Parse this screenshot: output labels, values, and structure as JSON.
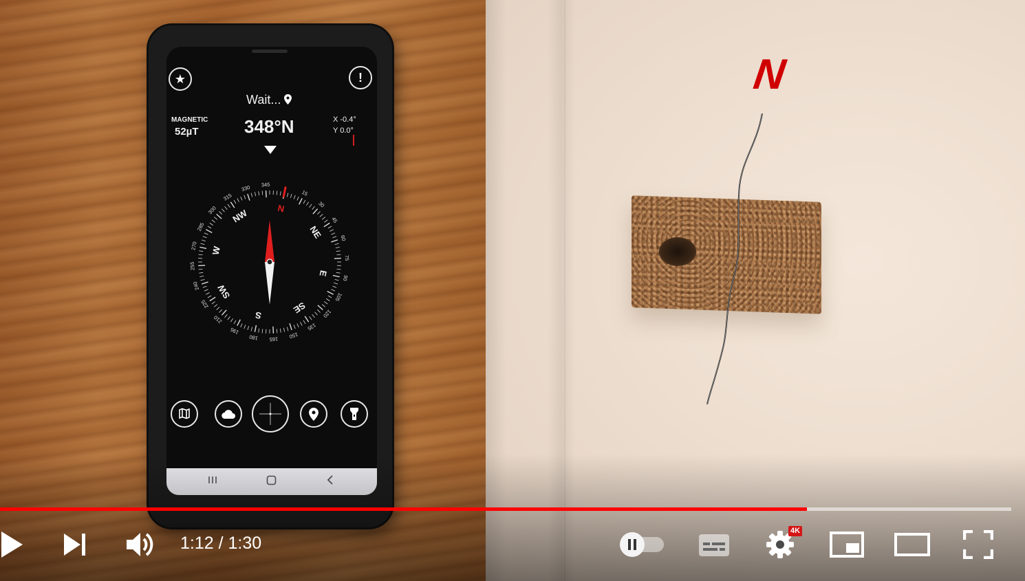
{
  "video": {
    "overlay_letter": "N",
    "phone_app": {
      "location_text": "Wait...",
      "magnetic_label": "MAGNETIC",
      "magnetic_value": "52µT",
      "heading": "348°N",
      "tilt_x": "X -0.4°",
      "tilt_y": "Y 0.0°",
      "info_symbol": "!",
      "favorite_symbol": "★",
      "dial": {
        "cardinals": [
          "N",
          "NE",
          "E",
          "SE",
          "S",
          "SW",
          "W",
          "NW"
        ],
        "degree_labels": [
          "345",
          "15",
          "30",
          "45",
          "60",
          "75",
          "90",
          "105",
          "120",
          "135",
          "150",
          "165",
          "180",
          "195",
          "210",
          "225",
          "240",
          "255",
          "270",
          "285",
          "300",
          "315",
          "330"
        ]
      },
      "toolbar_icons": [
        "map-icon",
        "cloud-icon",
        "crosshair-icon",
        "location-pin-icon",
        "flashlight-icon"
      ]
    }
  },
  "player": {
    "current_time": "1:12",
    "duration": "1:30",
    "time_text": "1:12 / 1:30",
    "progress_fraction": 0.798,
    "quality_badge": "4K",
    "accent_color": "#ff0000",
    "controls": [
      "play-icon",
      "next-icon",
      "volume-icon",
      "autoplay-toggle",
      "subtitles-icon",
      "settings-icon",
      "miniplayer-icon",
      "theater-icon",
      "fullscreen-icon"
    ]
  }
}
